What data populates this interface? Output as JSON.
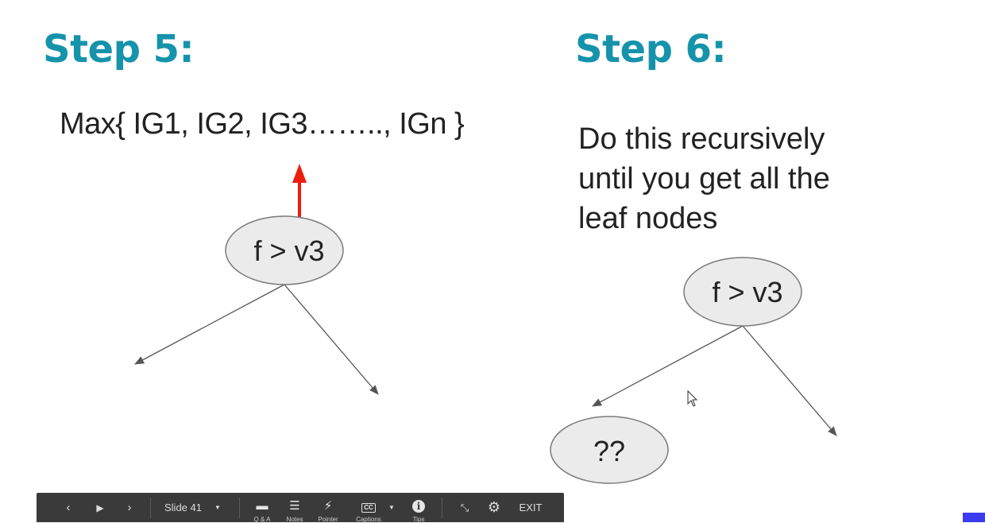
{
  "slide": {
    "step5_title": "Step 5:",
    "step6_title": "Step 6:",
    "formula": "Max{ IG1, IG2, IG3…….., IGn }",
    "step6_text": [
      "Do this recursively",
      "until you get all the",
      "leaf nodes"
    ],
    "step5_node_label": "f > v3",
    "step6_node_label": "f > v3",
    "unknown_node_label": "??",
    "colors": {
      "title": "#1593ab",
      "arrow_red": "#ee1c0d",
      "node_fill": "#ebebeb",
      "node_stroke": "#7a7a7a"
    }
  },
  "toolbar": {
    "prev_icon": "chevron-left-icon",
    "play_icon": "play-icon",
    "next_icon": "chevron-right-icon",
    "slide_label": "Slide 41",
    "tools": [
      {
        "name": "qa",
        "icon": "chat-bubbles-icon",
        "label": "Q & A"
      },
      {
        "name": "notes",
        "icon": "notes-icon",
        "label": "Notes"
      },
      {
        "name": "pointer",
        "icon": "lightning-icon",
        "label": "Pointer"
      },
      {
        "name": "captions",
        "icon": "cc-icon",
        "label": "Captions"
      },
      {
        "name": "tips",
        "icon": "info-icon",
        "label": "Tips"
      }
    ],
    "exit_label": "EXIT"
  }
}
